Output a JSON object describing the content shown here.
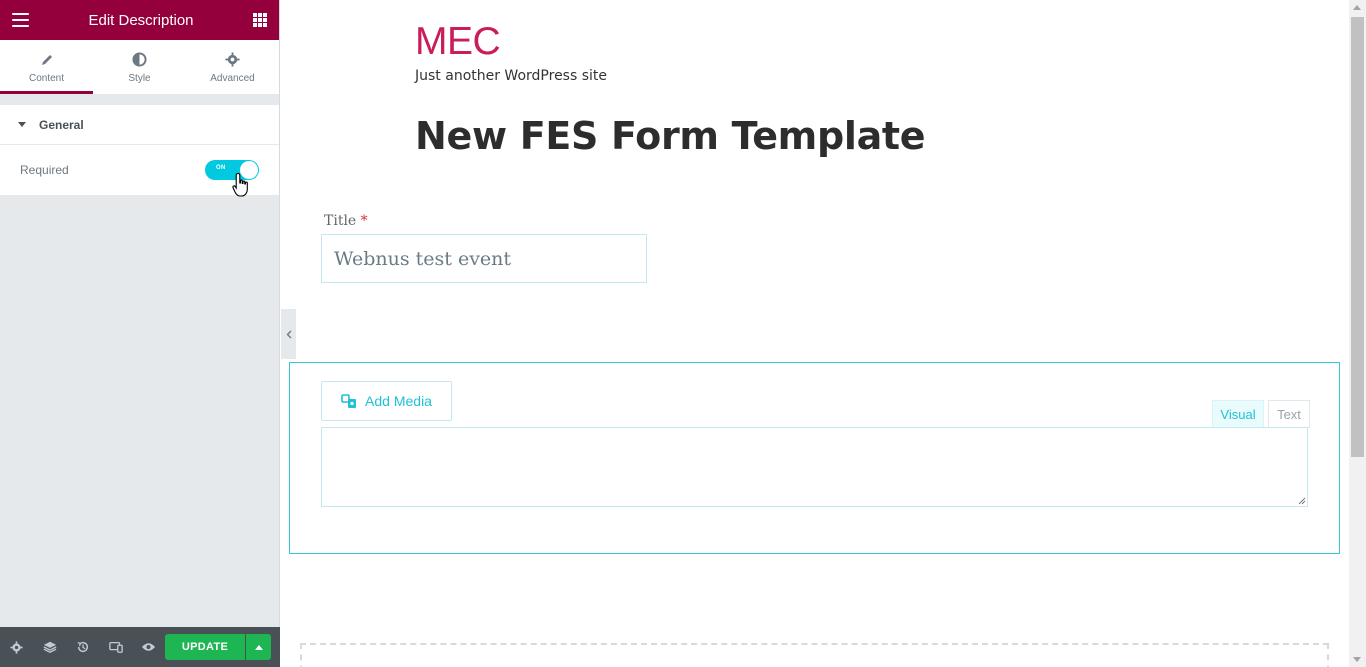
{
  "panel": {
    "title": "Edit Description",
    "tabs": [
      {
        "label": "Content",
        "icon": "pencil-icon",
        "active": true
      },
      {
        "label": "Style",
        "icon": "half-circle-icon",
        "active": false
      },
      {
        "label": "Advanced",
        "icon": "gear-icon",
        "active": false
      }
    ],
    "section_title": "General",
    "controls": {
      "required_label": "Required",
      "required_toggle_text": "ON",
      "required_state": true
    },
    "footer": {
      "update_label": "UPDATE",
      "icons": [
        "settings-icon",
        "layers-icon",
        "history-icon",
        "responsive-icon",
        "preview-icon"
      ]
    }
  },
  "preview": {
    "site_title": "MEC",
    "site_description": "Just another WordPress site",
    "page_title": "New FES Form Template",
    "title_field": {
      "label": "Title",
      "required_mark": "*",
      "value": "Webnus test event"
    },
    "editor": {
      "add_media_label": "Add Media",
      "visual_tab": "Visual",
      "text_tab": "Text",
      "content": ""
    }
  },
  "colors": {
    "brand": "#93003c",
    "site_title": "#c91e5c",
    "accent": "#1ec1d6",
    "update": "#1eb553"
  }
}
